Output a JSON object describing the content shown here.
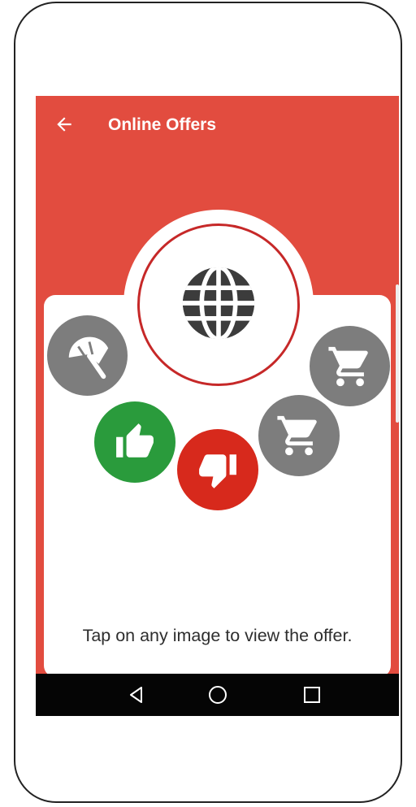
{
  "app_bar": {
    "title": "Online Offers",
    "back_icon": "arrow-left-icon"
  },
  "offers": {
    "center_icon": "globe-icon",
    "items": [
      {
        "icon": "beach-umbrella-icon",
        "color": "#7d7d7d"
      },
      {
        "icon": "thumbs-up-icon",
        "color": "#2a9b3c"
      },
      {
        "icon": "thumbs-down-icon",
        "color": "#d7291c"
      },
      {
        "icon": "shopping-cart-icon",
        "color": "#7d7d7d"
      },
      {
        "icon": "shopping-cart-icon",
        "color": "#7d7d7d"
      }
    ]
  },
  "caption": "Tap on any image to view the offer.",
  "nav_bar": {
    "back": "triangle-back-icon",
    "home": "circle-home-icon",
    "recents": "square-recents-icon"
  },
  "colors": {
    "primary": "#e24c3f",
    "card": "#ffffff",
    "navbar": "#050505"
  }
}
